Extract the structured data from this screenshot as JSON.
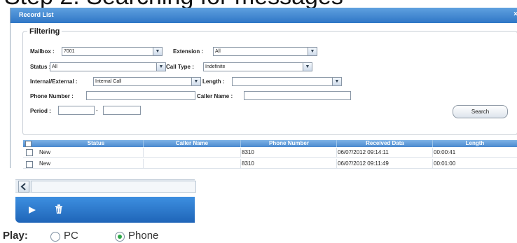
{
  "window": {
    "title": "Record List",
    "close_label": "×"
  },
  "filtering": {
    "legend": "Filtering",
    "mailbox": {
      "label": "Mailbox :",
      "value": "7001"
    },
    "extension": {
      "label": "Extension :",
      "value": "All"
    },
    "status": {
      "label": "Status :",
      "value": "All"
    },
    "call_type": {
      "label": "Call Type :",
      "value": "Indefinite"
    },
    "internal_external": {
      "label": "Internal/External :",
      "value": "Internal Call"
    },
    "length": {
      "label": "Length :",
      "value": ""
    },
    "phone_number": {
      "label": "Phone Number :",
      "value": ""
    },
    "caller_name": {
      "label": "Caller Name :",
      "value": ""
    },
    "period": {
      "label": "Period :",
      "separator": "-"
    },
    "search_label": "Search"
  },
  "table": {
    "columns": [
      "Status",
      "Caller Name",
      "Phone Number",
      "Received Data",
      "Length"
    ],
    "rows": [
      {
        "status": "New",
        "caller_name": "",
        "phone_number": "8310",
        "received": "06/07/2012 09:14:11",
        "length": "00:00:41"
      },
      {
        "status": "New",
        "caller_name": "",
        "phone_number": "8310",
        "received": "06/07/2012 09:11:49",
        "length": "00:01:00"
      }
    ]
  },
  "player": {
    "scroll_left_icon": "chevron-left-icon",
    "play_icon": "play-icon",
    "delete_icon": "trash-icon",
    "play_label": "Play:",
    "options": [
      {
        "label": "PC",
        "selected": false
      },
      {
        "label": "Phone",
        "selected": true
      }
    ]
  },
  "colors": {
    "title_bar": "#2f76c6",
    "header": "#4a89cf",
    "toolbar": "#1f65b8",
    "radio_selected": "#2fa84a"
  }
}
